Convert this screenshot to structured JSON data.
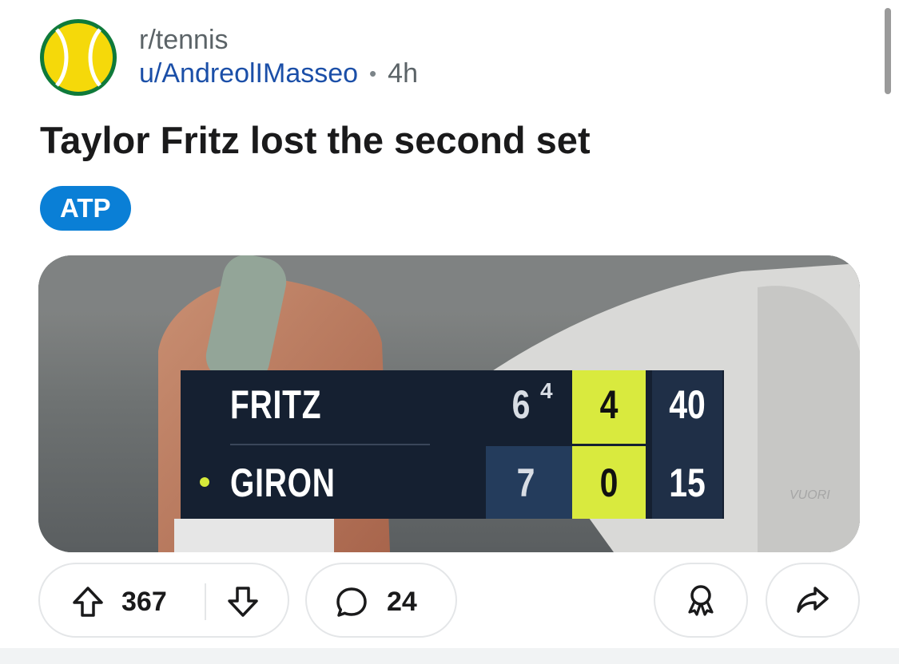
{
  "post": {
    "subreddit": "r/tennis",
    "username": "u/AndreolIMasseo",
    "separator": "•",
    "age": "4h",
    "title": "Taylor Fritz lost the second set",
    "flair": "ATP",
    "flair_color": "#0a7fd6",
    "avatar_icon": "tennis-ball-icon"
  },
  "scoreboard": {
    "players": [
      {
        "name": "FRITZ",
        "set2": "6",
        "tiebreak": "4",
        "games": "4",
        "points": "40",
        "serving": false
      },
      {
        "name": "GIRON",
        "set2": "7",
        "tiebreak": "",
        "games": "0",
        "points": "15",
        "serving": true
      }
    ],
    "highlight_color": "#d9ea3e",
    "panel_color": "#152031"
  },
  "actions": {
    "upvotes": "367",
    "comments": "24",
    "upvote_icon": "arrow-up-icon",
    "downvote_icon": "arrow-down-icon",
    "comment_icon": "comment-bubble-icon",
    "award_icon": "award-icon",
    "share_icon": "share-icon"
  }
}
